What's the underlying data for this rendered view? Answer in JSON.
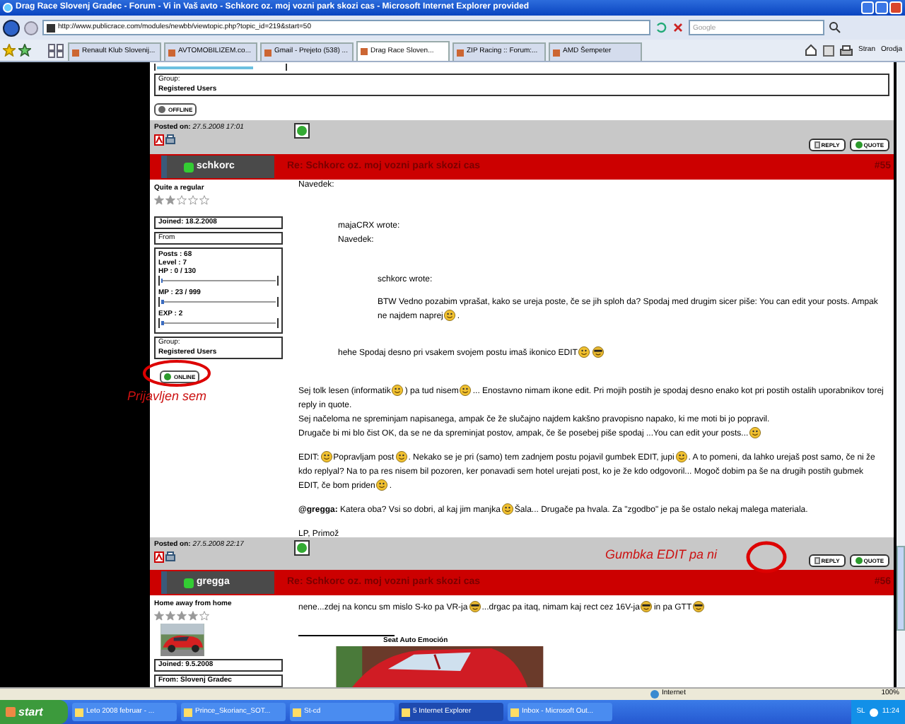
{
  "window": {
    "title": "Drag Race Slovenj Gradec - Forum - Vi in Vaš avto - Schkorc oz. moj vozni park skozi cas - Microsoft Internet Explorer provided"
  },
  "address_bar": {
    "url": "http://www.publicrace.com/modules/newbb/viewtopic.php?topic_id=219&start=50"
  },
  "search": {
    "placeholder": "Google"
  },
  "tabs": [
    {
      "label": "Renault Klub Slovenij...",
      "selected": false
    },
    {
      "label": "AVTOMOBILIZEM.co...",
      "selected": false
    },
    {
      "label": "Gmail - Prejeto (538) ...",
      "selected": false
    },
    {
      "label": "Drag Race Sloven...",
      "selected": true
    },
    {
      "label": "ZIP Racing :: Forum:...",
      "selected": false
    },
    {
      "label": "AMD Šempeter",
      "selected": false
    }
  ],
  "toolbar": [
    "Stran",
    "Orodja"
  ],
  "previous_post": {
    "group_label": "Group:",
    "group": "Registered Users",
    "status": {
      "label": "OFFLINE",
      "online": false
    },
    "posted_label": "Posted on:",
    "posted": "27.5.2008 17:01",
    "buttons": [
      "REPLY",
      "QUOTE"
    ]
  },
  "posts": [
    {
      "author": "schkorc",
      "title": "Re: Schkorc oz. moj vozni park skozi cas",
      "number": "#55",
      "rank": "Quite a regular",
      "stars": 2,
      "joined_label": "Joined:",
      "joined": "18.2.2008",
      "from": "From",
      "stats": [
        {
          "kind": "text",
          "text": "Posts : 68"
        },
        {
          "kind": "text",
          "text": "Level : 7"
        },
        {
          "kind": "bar",
          "text": "HP : 0 / 130",
          "level": 0
        },
        {
          "kind": "bar",
          "text": "MP : 23 / 999",
          "level": 0.02
        },
        {
          "kind": "bar",
          "text": "EXP : 2",
          "level": 0.02
        }
      ],
      "group_label": "Group:",
      "group": "Registered Users",
      "status": {
        "label": "ONLINE",
        "online": true
      },
      "body": {
        "intro": "Navedek:",
        "quote": {
          "author": "majaCRX wrote:",
          "intro": "Navedek:",
          "quote": {
            "author": "schkorc wrote:",
            "paragraphs": [
              [
                {
                  "kind": "text",
                  "text": "BTW Vedno pozabim vprašat, kako se ureja poste, če se jih sploh da? Spodaj med drugim sicer piše: You can edit your posts. Ampak ne najdem naprej"
                },
                {
                  "kind": "smiley"
                },
                {
                  "kind": "text",
                  "text": "."
                }
              ]
            ]
          },
          "paragraphs": [
            [
              {
                "kind": "text",
                "text": "hehe Spodaj desno pri vsakem svojem postu imaš ikonico EDIT"
              },
              {
                "kind": "smiley"
              },
              {
                "kind": "cool"
              }
            ]
          ]
        },
        "paragraphs": [
          [
            {
              "kind": "text",
              "text": "Sej tolk lesen (informatik"
            },
            {
              "kind": "smiley"
            },
            {
              "kind": "text",
              "text": ") pa tud nisem"
            },
            {
              "kind": "smiley"
            },
            {
              "kind": "text",
              "text": "... Enostavno nimam ikone edit. Pri mojih postih je spodaj desno enako kot pri postih ostalih uporabnikov torej reply in quote.\nSej načeloma ne spreminjam napisanega, ampak če že slučajno najdem kakšno pravopisno napako, ki me moti bi jo popravil.\nDrugače bi mi blo čist OK, da se ne da spreminjat postov, ampak, če še posebej piše spodaj ...You can edit your posts..."
            },
            {
              "kind": "smiley"
            }
          ],
          [
            {
              "kind": "text",
              "text": "EDIT:"
            },
            {
              "kind": "smiley"
            },
            {
              "kind": "text",
              "text": "Popravljam post"
            },
            {
              "kind": "smiley"
            },
            {
              "kind": "text",
              "text": ". Nekako se je pri (samo) tem zadnjem postu pojavil gumbek EDIT, jupi"
            },
            {
              "kind": "smiley"
            },
            {
              "kind": "text",
              "text": ". A to pomeni, da lahko urejaš post samo, če ni že kdo replyal? Na to pa res nisem bil pozoren, ker ponavadi sem hotel urejati post, ko je že kdo odgovoril... Mogoč dobim pa še na drugih postih gubmek EDIT, če bom priden"
            },
            {
              "kind": "smiley"
            },
            {
              "kind": "text",
              "text": "."
            }
          ],
          [
            {
              "kind": "text",
              "text": "**@gregga:** Katera oba? Vsi so dobri, al kaj jim manjka"
            },
            {
              "kind": "smiley"
            },
            {
              "kind": "text",
              "text": "Šala... Drugače pa hvala. Za \"zgodbo\" je pa še ostalo nekaj malega materiala."
            }
          ],
          [
            {
              "kind": "text",
              "text": "LP, Primož"
            }
          ]
        ]
      },
      "posted_label": "Posted on:",
      "posted": "27.5.2008 22:17",
      "buttons": [
        "REPLY",
        "QUOTE"
      ]
    },
    {
      "author": "gregga",
      "title": "Re: Schkorc oz. moj vozni park skozi cas",
      "number": "#56",
      "rank": "Home away from home",
      "stars": 4,
      "joined_label": "Joined:",
      "joined": "9.5.2008",
      "from": "From: Slovenj Gradec",
      "body": {
        "paragraphs": [
          [
            {
              "kind": "text",
              "text": "nene...zdej na koncu sm mislo S-ko pa VR-ja"
            },
            {
              "kind": "cool"
            },
            {
              "kind": "text",
              "text": "...drgac pa itaq, nimam kaj rect cez 16V-ja"
            },
            {
              "kind": "cool"
            },
            {
              "kind": "text",
              "text": "in pa GTT"
            },
            {
              "kind": "cool"
            }
          ]
        ]
      },
      "signature": {
        "title": "Seat Auto Emoción"
      }
    }
  ],
  "annotations": [
    "Prijavljen sem",
    "Gumbka EDIT pa ni"
  ],
  "status_bar": {
    "zone": "Internet",
    "zoom": "100%"
  },
  "taskbar": {
    "start": "start",
    "items": [
      {
        "label": "Leto 2008 februar - ...",
        "selected": false
      },
      {
        "label": "Prince_Skorianc_SOT...",
        "selected": false
      },
      {
        "label": "St-cd",
        "selected": false
      },
      {
        "label": "5 Internet Explorer",
        "selected": true
      },
      {
        "label": "Inbox - Microsoft Out...",
        "selected": false
      }
    ],
    "language": "SL",
    "clock": "11:24"
  }
}
